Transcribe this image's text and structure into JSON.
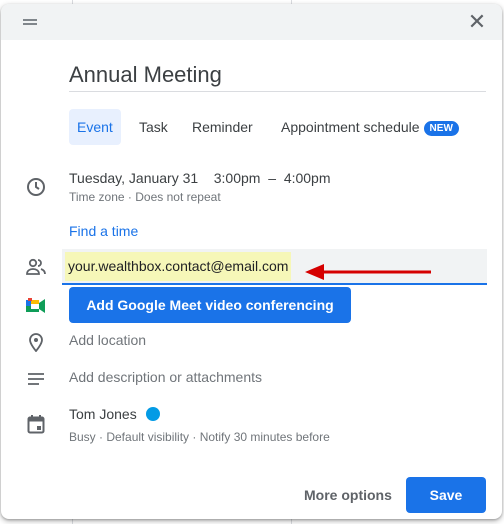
{
  "title": "Annual Meeting",
  "tabs": [
    {
      "label": "Event",
      "active": true
    },
    {
      "label": "Task"
    },
    {
      "label": "Reminder"
    },
    {
      "label": "Appointment schedule",
      "badge": "NEW"
    }
  ],
  "datetime": {
    "date": "Tuesday, January 31",
    "start": "3:00pm",
    "separator": "–",
    "end": "4:00pm",
    "timezone_link": "Time zone",
    "dot": "·",
    "repeat": "Does not repeat"
  },
  "find_time": "Find a time",
  "guests": {
    "value": "your.wealthbox.contact@email.com",
    "highlight_color": "#f6f7b8"
  },
  "annotation": {
    "arrow_color": "#d50000"
  },
  "meet_button": "Add Google Meet video conferencing",
  "location_placeholder": "Add location",
  "description_placeholder": "Add description or attachments",
  "calendar": {
    "owner": "Tom Jones",
    "color": "#039be5",
    "details": "Busy · Default visibility · Notify 30 minutes before"
  },
  "footer": {
    "more_options": "More options",
    "save": "Save"
  },
  "accent": "#1a73e8"
}
